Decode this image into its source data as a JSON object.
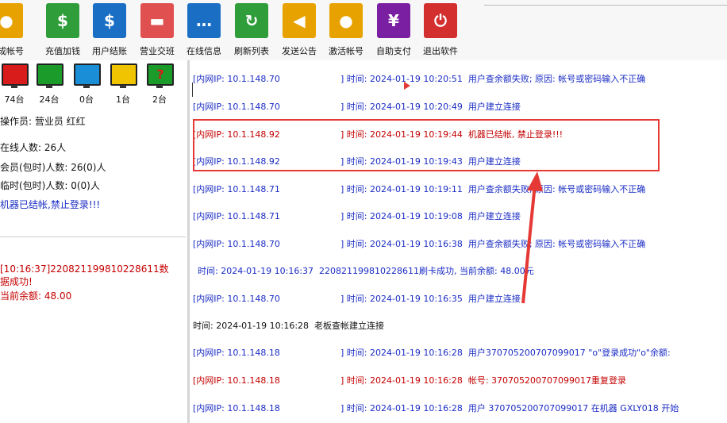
{
  "toolbar": {
    "buttons": [
      {
        "label": "生成帐号",
        "icon": "user-icon",
        "color": "#e8a200"
      },
      {
        "label": "充值加钱",
        "icon": "money-bag-icon",
        "color": "#2e9d3a"
      },
      {
        "label": "用户结账",
        "icon": "dollar-bill-icon",
        "color": "#1a6fc4"
      },
      {
        "label": "营业交班",
        "icon": "printer-icon",
        "color": "#e05050"
      },
      {
        "label": "在线信息",
        "icon": "chat-icon",
        "color": "#1a6fc4"
      },
      {
        "label": "刷新列表",
        "icon": "refresh-icon",
        "color": "#2e9d3a"
      },
      {
        "label": "发送公告",
        "icon": "megaphone-icon",
        "color": "#e8a200"
      },
      {
        "label": "激活帐号",
        "icon": "user-activate-icon",
        "color": "#e8a200"
      },
      {
        "label": "自助支付",
        "icon": "yen-icon",
        "color": "#7b1fa2"
      },
      {
        "label": "退出软件",
        "icon": "power-icon",
        "color": "#d32f2f"
      }
    ]
  },
  "monitors": [
    {
      "label": "74台",
      "color": "#d81b1b"
    },
    {
      "label": "24台",
      "color": "#1a9b2a"
    },
    {
      "label": "0台",
      "color": "#1a8fd8"
    },
    {
      "label": "1台",
      "color": "#f0c400"
    },
    {
      "label": "2台",
      "color": "#1a9b2a",
      "symbol": "?"
    }
  ],
  "status": {
    "operator": "操作员: 营业员 红红",
    "online": "在线人数: 26人",
    "members": "会员(包时)人数: 26(0)人",
    "temp": "临时(包时)人数: 0(0)人",
    "machine_notice": "机器已结帐,禁止登录!!!"
  },
  "card_message": {
    "line1": "[10:16:37]220821199810228611数",
    "line2": "据成功!",
    "line3": "当前余额: 48.00"
  },
  "log": [
    {
      "color": "blue",
      "ip": "[内网IP: 10.1.148.70",
      "time": "] 时间: 2024-01-19 10:20:51",
      "msg": "用户查余额失败; 原因: 帐号或密码输入不正确"
    },
    {
      "color": "blue",
      "ip": "[内网IP: 10.1.148.70",
      "time": "] 时间: 2024-01-19 10:20:49",
      "msg": "用户建立连接"
    },
    {
      "color": "red",
      "ip": "[内网IP: 10.1.148.92",
      "time": "] 时间: 2024-01-19 10:19:44",
      "msg": "机器已结帐, 禁止登录!!!"
    },
    {
      "color": "blue",
      "ip": "[内网IP: 10.1.148.92",
      "time": "] 时间: 2024-01-19 10:19:43",
      "msg": "用户建立连接"
    },
    {
      "color": "blue",
      "ip": "[内网IP: 10.1.148.71",
      "time": "] 时间: 2024-01-19 10:19:11",
      "msg": "用户查余额失败; 原因: 帐号或密码输入不正确"
    },
    {
      "color": "blue",
      "ip": "[内网IP: 10.1.148.71",
      "time": "] 时间: 2024-01-19 10:19:08",
      "msg": "用户建立连接"
    },
    {
      "color": "blue",
      "ip": "[内网IP: 10.1.148.70",
      "time": "] 时间: 2024-01-19 10:16:38",
      "msg": "用户查余额失败; 原因: 帐号或密码输入不正确"
    },
    {
      "color": "blue",
      "ip": "",
      "time": "时间: 2024-01-19 10:16:37",
      "msg": "220821199810228611刷卡成功, 当前余额: 48.00元"
    },
    {
      "color": "blue",
      "ip": "[内网IP: 10.1.148.70",
      "time": "] 时间: 2024-01-19 10:16:35",
      "msg": "用户建立连接"
    },
    {
      "color": "black",
      "ip": "",
      "time": "时间: 2024-01-19 10:16:28",
      "msg": "老板查帐建立连接"
    },
    {
      "color": "blue",
      "ip": "[内网IP: 10.1.148.18",
      "time": "] 时间: 2024-01-19 10:16:28",
      "msg": "用户370705200707099017 \"o\"登录成功\"o\"余额:"
    },
    {
      "color": "red",
      "ip": "[内网IP: 10.1.148.18",
      "time": "] 时间: 2024-01-19 10:16:28",
      "msg": "帐号: 370705200707099017重复登录"
    },
    {
      "color": "blue",
      "ip": "[内网IP: 10.1.148.18",
      "time": "] 时间: 2024-01-19 10:16:28",
      "msg": "用户 370705200707099017 在机器 GXLY018 开始"
    }
  ]
}
